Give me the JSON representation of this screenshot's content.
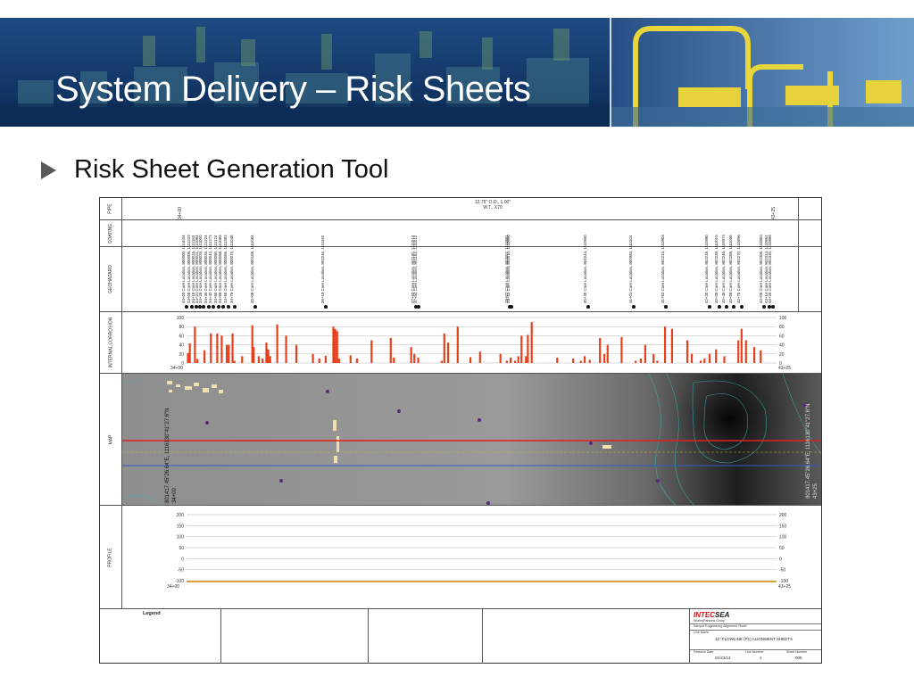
{
  "slide": {
    "title": "System Delivery – Risk Sheets",
    "bullet": "Risk Sheet Generation Tool"
  },
  "colors": {
    "banner_dark": "#0f2a5a",
    "banner_light": "#4f86b8",
    "bar_red": "#e8401c",
    "route_red": "#e02020",
    "route_blue": "#2f5fc0",
    "profile_orange": "#d9a23a",
    "logo_red": "#cc1a1a"
  },
  "icons": {
    "bullet": "triangle-bullet-icon"
  },
  "sheet": {
    "row_labels": {
      "pipe": "PIPE",
      "coating": "COATING",
      "geohazard": "GEOHAZARD",
      "internal_corrosion": "INTERNAL CORROSION",
      "map": "MAP",
      "profile": "PROFILE"
    },
    "pipe": {
      "kp_start": "34+00",
      "kp_end": "43+25",
      "description_line1": "12.75\" O.D., 1.00\"",
      "description_line2": "W.T., X70"
    },
    "geohazard": {
      "labels": [
        "34+00 Core Location, 800000, 1111034",
        "34+08 Core Location, 800008, 1111229",
        "34+15 Core Location, 800015, 1111163",
        "34+21 Core Location, 800021, 1111084",
        "34+26 Core Location, 800026, 1111000",
        "34+35 Core Location, 800035, 1111224",
        "34+42 Core Location, 800042, 1111273",
        "34+50 Core Location, 800050, 1111124",
        "34+58 Core Location, 800058, 1111083",
        "34+66 Core Location, 800066, 1111363",
        "34+76 Core Location, 800076, 1111048",
        "35+08 Core Location, 800108, 1111084",
        "36+19 Core Location, 801046, 1111162",
        "37+60 Core Location, 801160, 1111014",
        "37+64 Core Location, 801164, 1111012",
        "39+07 Core Location, 802007, 1110881",
        "39+10 Core Location, 802010, 1110960",
        "40+30 Core Location, 801044, 1110960",
        "41+01 Core Location, 800983, 1111104",
        "41+52 Core Location, 802213, 1110904",
        "42+20 Core Location, 802218, 1110980",
        "42+35 Core Location, 802235, 1111019",
        "42+46 Core Location, 802246, 1110974",
        "42+58 Core Location, 802258, 1111066",
        "42+70 Core Location, 802270, 1110896",
        "43+06 Core Location, 802306, 1110853",
        "43+14 Core Location, 802314, 1110861",
        "43+20 Core Location, 802320, 1110886"
      ]
    },
    "corrosion": {
      "y_ticks": [
        "100",
        "80",
        "60",
        "40",
        "20",
        "0"
      ],
      "kp_start": "34+00",
      "kp_end": "43+25"
    },
    "map": {
      "coord_left": "801417.45\"26.64\"E, 1116130\"41\"27.6\"N",
      "kp_left": "34+00",
      "coord_right": "801417.45\"26.64\"E, 1116130\"41\"27.6\"N",
      "kp_right": "43+25"
    },
    "profile": {
      "y_ticks": [
        "200",
        "150",
        "100",
        "50",
        "0",
        "-50",
        "-100"
      ],
      "kp_start": "34+00",
      "kp_end": "43+25"
    },
    "legend": {
      "title": "Legend"
    },
    "title_block": {
      "company": "INTECSEA",
      "company_prefix": "INTEC",
      "company_suffix": "SEA",
      "group": "WorleyParsons Group",
      "sheet_name": "Sample Engineering Alignment Sheet",
      "line_name_label": "Line Name",
      "line_name": "12\" FLOWLINE (P1) ALIGNMENT SHEETS",
      "revision_date_label": "Revision Date",
      "revision_date": "01/23/13",
      "line_number_label": "Line Number",
      "line_number": "1",
      "sheet_number_label": "Sheet Number",
      "sheet_number": "005"
    }
  },
  "chart_data": {
    "type": "bar",
    "x_range": [
      "34+00",
      "43+25"
    ],
    "ylim": [
      0,
      100
    ],
    "x": [
      34.02,
      34.05,
      34.13,
      34.17,
      34.28,
      34.38,
      34.48,
      34.55,
      34.63,
      34.66,
      34.72,
      34.75,
      34.87,
      35.03,
      35.05,
      35.13,
      35.19,
      35.25,
      35.28,
      35.31,
      35.42,
      35.56,
      35.72,
      35.98,
      36.08,
      36.18,
      36.3,
      36.33,
      36.36,
      36.39,
      36.57,
      36.67,
      36.9,
      37.2,
      37.25,
      37.52,
      37.57,
      37.63,
      38.0,
      38.04,
      38.1,
      38.25,
      38.45,
      38.6,
      38.92,
      39.02,
      39.08,
      39.15,
      39.2,
      39.25,
      39.32,
      39.35,
      39.41,
      39.81,
      40.06,
      40.18,
      40.24,
      40.32,
      40.48,
      40.55,
      40.6,
      40.82,
      41.04,
      41.12,
      41.19,
      41.32,
      41.38,
      41.5,
      41.61,
      41.85,
      41.92,
      42.06,
      42.12,
      42.2,
      42.3,
      42.43,
      42.65,
      42.7,
      42.77,
      42.9,
      43.0
    ],
    "values": [
      22,
      43,
      80,
      9,
      28,
      65,
      65,
      60,
      40,
      40,
      65,
      5,
      15,
      83,
      35,
      15,
      10,
      45,
      30,
      15,
      85,
      60,
      40,
      20,
      10,
      16,
      80,
      75,
      70,
      10,
      17,
      10,
      50,
      55,
      12,
      35,
      20,
      12,
      5,
      65,
      45,
      80,
      13,
      25,
      20,
      5,
      12,
      5,
      15,
      60,
      15,
      62,
      90,
      12,
      10,
      5,
      15,
      7,
      55,
      20,
      40,
      57,
      5,
      10,
      40,
      20,
      5,
      80,
      75,
      50,
      20,
      5,
      10,
      20,
      30,
      15,
      50,
      75,
      50,
      35,
      28
    ],
    "xlabel": "",
    "ylabel": ""
  }
}
